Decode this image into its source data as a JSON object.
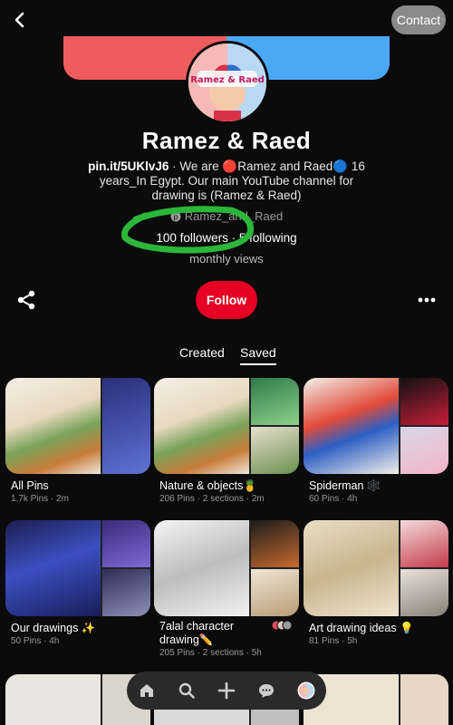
{
  "header": {
    "contact_label": "Contact"
  },
  "profile": {
    "cover_left_color": "#f05c5e",
    "cover_right_color": "#4aa9f5",
    "avatar_text": "Ramez & Raed",
    "name": "Ramez & Raed",
    "link": "pin.it/5UKlvJ6",
    "bio": " · We are 🔴Ramez and Raed🔵 16 years_In Egypt. Our main YouTube channel for drawing is (Ramez & Raed)",
    "handle": "Ramez_and_Raed",
    "followers": "100 followers",
    "following": "5 following",
    "separator": " · ",
    "monthly_views": "monthly views",
    "follow_label": "Follow"
  },
  "tabs": [
    {
      "label": "Created"
    },
    {
      "label": "Saved"
    }
  ],
  "boards": [
    {
      "title": "All Pins",
      "meta": "1.7k Pins · 2m"
    },
    {
      "title": "Nature & objects🍍",
      "meta": "206 Pins · 2 sections · 2m"
    },
    {
      "title": "Spiderman 🕸️",
      "meta": "60 Pins · 4h"
    },
    {
      "title": "Our drawings ✨",
      "meta": "50 Pins · 4h"
    },
    {
      "title": "7alal character drawing✏️",
      "meta": "205 Pins · 2 sections · 5h"
    },
    {
      "title": "Art drawing ideas 💡",
      "meta": "81 Pins · 5h"
    }
  ],
  "icons": {
    "back": "chevron-left-icon",
    "share": "share-icon",
    "more": "more-icon",
    "home": "home-icon",
    "search": "search-icon",
    "add": "plus-icon",
    "messages": "chat-icon"
  },
  "colors": {
    "accent": "#e60023",
    "highlight_circle": "#2bb63a"
  }
}
